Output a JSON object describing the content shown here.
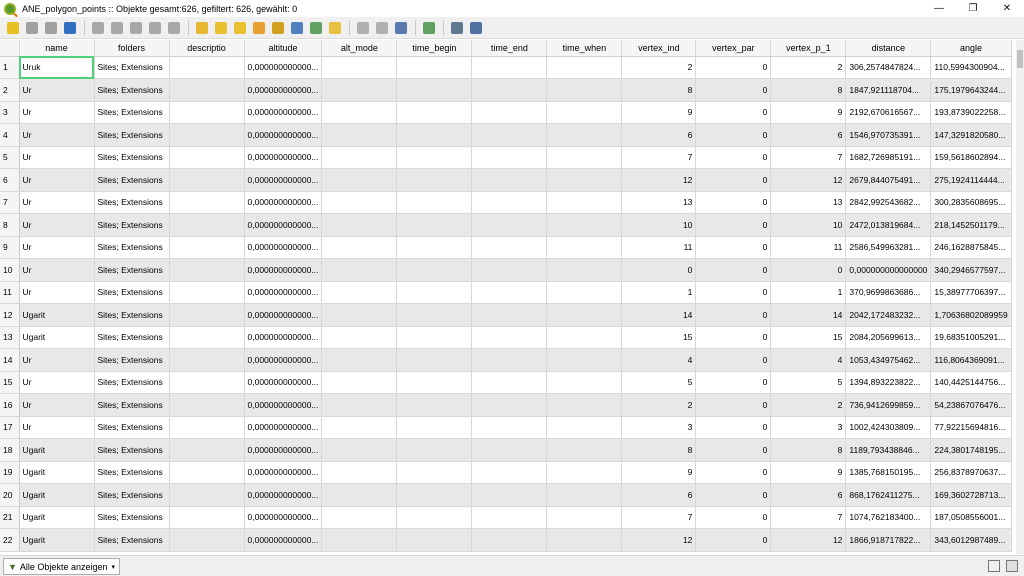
{
  "window": {
    "title": "ANE_polygon_points :: Objekte gesamt:626, gefiltert: 626, gewählt: 0",
    "controls": [
      "—",
      "❐",
      "✕"
    ]
  },
  "toolbar": {
    "icons": [
      {
        "name": "edit-pencil-icon",
        "color": "#e8c020"
      },
      {
        "name": "multi-edit-icon",
        "color": "#a0a0a0"
      },
      {
        "name": "save-icon",
        "color": "#a0a0a0"
      },
      {
        "name": "reload-icon",
        "color": "#2f6ec0"
      },
      {
        "sep": true
      },
      {
        "name": "add-feature-icon",
        "color": "#a8a8a8"
      },
      {
        "name": "delete-feature-icon",
        "color": "#a8a8a8"
      },
      {
        "name": "cut-icon",
        "color": "#a8a8a8"
      },
      {
        "name": "copy-icon",
        "color": "#a8a8a8"
      },
      {
        "name": "paste-icon",
        "color": "#a8a8a8"
      },
      {
        "sep": true
      },
      {
        "name": "select-expression-icon",
        "color": "#e8b830"
      },
      {
        "name": "select-all-icon",
        "color": "#e8c030"
      },
      {
        "name": "invert-selection-icon",
        "color": "#e8c030"
      },
      {
        "name": "deselect-icon",
        "color": "#e8a030"
      },
      {
        "name": "filter-select-icon",
        "color": "#d0a020"
      },
      {
        "name": "move-selection-top-icon",
        "color": "#5080c0"
      },
      {
        "name": "pan-to-selection-icon",
        "color": "#60a060"
      },
      {
        "name": "zoom-to-selection-icon",
        "color": "#e8c040"
      },
      {
        "sep": true
      },
      {
        "name": "new-field-icon",
        "color": "#b0b0b0"
      },
      {
        "name": "delete-field-icon",
        "color": "#b0b0b0"
      },
      {
        "name": "field-calculator-icon",
        "color": "#5a7ab0"
      },
      {
        "sep": true
      },
      {
        "name": "conditional-format-icon",
        "color": "#60a060"
      },
      {
        "sep": true
      },
      {
        "name": "dock-table-icon",
        "color": "#607890"
      },
      {
        "name": "actions-icon",
        "color": "#5070a0"
      }
    ]
  },
  "table": {
    "columns": [
      "name",
      "folders",
      "descriptio",
      "altitude",
      "alt_mode",
      "time_begin",
      "time_end",
      "time_when",
      "vertex_ind",
      "vertex_par",
      "vertex_p_1",
      "distance",
      "angle"
    ],
    "rows": [
      [
        "1",
        "Uruk",
        "Sites; Extensions",
        "",
        "0,000000000000...",
        "",
        "",
        "",
        "",
        "2",
        "0",
        "2",
        "306,2574847824...",
        "110,5994300904..."
      ],
      [
        "2",
        "Ur",
        "Sites; Extensions",
        "",
        "0,000000000000...",
        "",
        "",
        "",
        "",
        "8",
        "0",
        "8",
        "1847,921118704...",
        "175,1979643244..."
      ],
      [
        "3",
        "Ur",
        "Sites; Extensions",
        "",
        "0,000000000000...",
        "",
        "",
        "",
        "",
        "9",
        "0",
        "9",
        "2192,670616567...",
        "193,8739022258..."
      ],
      [
        "4",
        "Ur",
        "Sites; Extensions",
        "",
        "0,000000000000...",
        "",
        "",
        "",
        "",
        "6",
        "0",
        "6",
        "1546,970735391...",
        "147,3291820580..."
      ],
      [
        "5",
        "Ur",
        "Sites; Extensions",
        "",
        "0,000000000000...",
        "",
        "",
        "",
        "",
        "7",
        "0",
        "7",
        "1682,726985191...",
        "159,5618602894..."
      ],
      [
        "6",
        "Ur",
        "Sites; Extensions",
        "",
        "0,000000000000...",
        "",
        "",
        "",
        "",
        "12",
        "0",
        "12",
        "2679,844075491...",
        "275,1924114444..."
      ],
      [
        "7",
        "Ur",
        "Sites; Extensions",
        "",
        "0,000000000000...",
        "",
        "",
        "",
        "",
        "13",
        "0",
        "13",
        "2842,992543682...",
        "300,2835608695..."
      ],
      [
        "8",
        "Ur",
        "Sites; Extensions",
        "",
        "0,000000000000...",
        "",
        "",
        "",
        "",
        "10",
        "0",
        "10",
        "2472,013819684...",
        "218,1452501179..."
      ],
      [
        "9",
        "Ur",
        "Sites; Extensions",
        "",
        "0,000000000000...",
        "",
        "",
        "",
        "",
        "11",
        "0",
        "11",
        "2586,549963281...",
        "246,1628875845..."
      ],
      [
        "10",
        "Ur",
        "Sites; Extensions",
        "",
        "0,000000000000...",
        "",
        "",
        "",
        "",
        "0",
        "0",
        "0",
        "0,000000000000000",
        "340,2946577597..."
      ],
      [
        "11",
        "Ur",
        "Sites; Extensions",
        "",
        "0,000000000000...",
        "",
        "",
        "",
        "",
        "1",
        "0",
        "1",
        "370,9699863686...",
        "15,38977706397..."
      ],
      [
        "12",
        "Ugarit",
        "Sites; Extensions",
        "",
        "0,000000000000...",
        "",
        "",
        "",
        "",
        "14",
        "0",
        "14",
        "2042,172483232...",
        "1,70636802089959"
      ],
      [
        "13",
        "Ugarit",
        "Sites; Extensions",
        "",
        "0,000000000000...",
        "",
        "",
        "",
        "",
        "15",
        "0",
        "15",
        "2084,205699613...",
        "19,68351005291..."
      ],
      [
        "14",
        "Ur",
        "Sites; Extensions",
        "",
        "0,000000000000...",
        "",
        "",
        "",
        "",
        "4",
        "0",
        "4",
        "1053,434975462...",
        "116,8064369091..."
      ],
      [
        "15",
        "Ur",
        "Sites; Extensions",
        "",
        "0,000000000000...",
        "",
        "",
        "",
        "",
        "5",
        "0",
        "5",
        "1394,893223822...",
        "140,4425144756..."
      ],
      [
        "16",
        "Ur",
        "Sites; Extensions",
        "",
        "0,000000000000...",
        "",
        "",
        "",
        "",
        "2",
        "0",
        "2",
        "736,9412699859...",
        "54,23867076476..."
      ],
      [
        "17",
        "Ur",
        "Sites; Extensions",
        "",
        "0,000000000000...",
        "",
        "",
        "",
        "",
        "3",
        "0",
        "3",
        "1002,424303809...",
        "77,92215694816..."
      ],
      [
        "18",
        "Ugarit",
        "Sites; Extensions",
        "",
        "0,000000000000...",
        "",
        "",
        "",
        "",
        "8",
        "0",
        "8",
        "1189,793438846...",
        "224,3801748195..."
      ],
      [
        "19",
        "Ugarit",
        "Sites; Extensions",
        "",
        "0,000000000000...",
        "",
        "",
        "",
        "",
        "9",
        "0",
        "9",
        "1385,768150195...",
        "256,8378970637..."
      ],
      [
        "20",
        "Ugarit",
        "Sites; Extensions",
        "",
        "0,000000000000...",
        "",
        "",
        "",
        "",
        "6",
        "0",
        "6",
        "868,1762411275...",
        "169,3602728713..."
      ],
      [
        "21",
        "Ugarit",
        "Sites; Extensions",
        "",
        "0,000000000000...",
        "",
        "",
        "",
        "",
        "7",
        "0",
        "7",
        "1074,762183400...",
        "187,0508556001..."
      ],
      [
        "22",
        "Ugarit",
        "Sites; Extensions",
        "",
        "0,000000000000...",
        "",
        "",
        "",
        "",
        "12",
        "0",
        "12",
        "1866,918717822...",
        "343,6012987489..."
      ]
    ]
  },
  "statusbar": {
    "filter_label": "Alle Objekte anzeigen"
  }
}
